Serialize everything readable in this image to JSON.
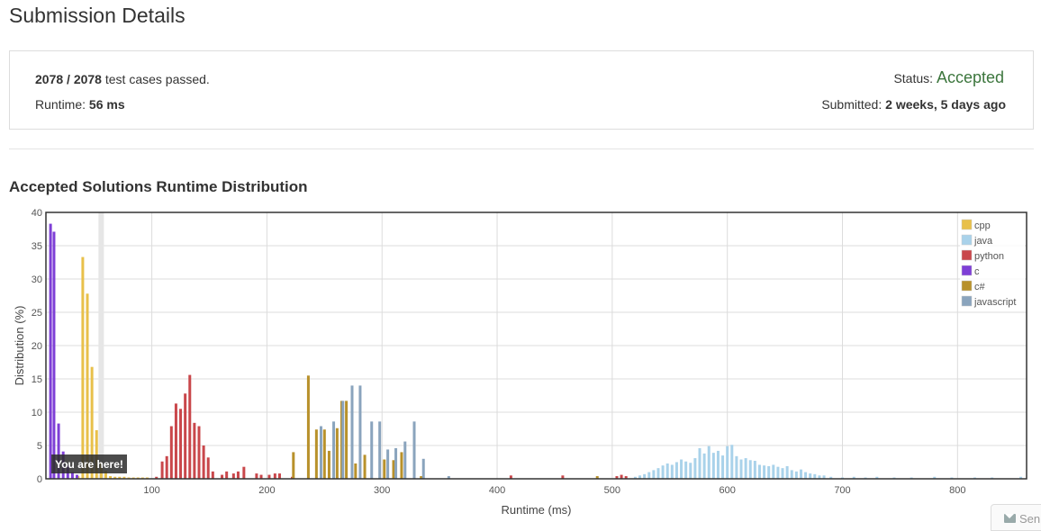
{
  "page": {
    "title": "Submission Details"
  },
  "summary": {
    "passed": "2078",
    "total": "2078",
    "passed_suffix": "test cases passed.",
    "runtime_label": "Runtime:",
    "runtime_value": "56 ms",
    "status_label": "Status:",
    "status_value": "Accepted",
    "status_color": "#3c763d",
    "submitted_label": "Submitted:",
    "submitted_value": "2 weeks, 5 days ago"
  },
  "chart_section": {
    "title": "Accepted Solutions Runtime Distribution"
  },
  "chart_data": {
    "type": "bar",
    "xlabel": "Runtime (ms)",
    "ylabel": "Distribution (%)",
    "xlim": [
      8,
      860
    ],
    "ylim": [
      0,
      40
    ],
    "xticks": [
      100,
      200,
      300,
      400,
      500,
      600,
      700,
      800
    ],
    "yticks": [
      0,
      5,
      10,
      15,
      20,
      25,
      30,
      35,
      40
    ],
    "grid": true,
    "legend_position": "top-right",
    "marker": {
      "x": 56,
      "label": "You are here!"
    },
    "series": [
      {
        "name": "cpp",
        "color": "#e8c04a",
        "points": [
          [
            36,
            0.4
          ],
          [
            40,
            33.3
          ],
          [
            44,
            27.8
          ],
          [
            48,
            16.8
          ],
          [
            52,
            7.3
          ],
          [
            56,
            2.5
          ],
          [
            60,
            1.2
          ],
          [
            64,
            0.4
          ],
          [
            68,
            0.3
          ],
          [
            72,
            0.3
          ],
          [
            76,
            0.3
          ],
          [
            80,
            0.2
          ],
          [
            84,
            0.2
          ],
          [
            88,
            0.2
          ],
          [
            92,
            0.2
          ],
          [
            96,
            0.2
          ]
        ]
      },
      {
        "name": "java",
        "color": "#a9d2ea",
        "points": [
          [
            520,
            0.3
          ],
          [
            524,
            0.5
          ],
          [
            528,
            0.7
          ],
          [
            532,
            1.0
          ],
          [
            536,
            1.3
          ],
          [
            540,
            1.6
          ],
          [
            544,
            2.0
          ],
          [
            548,
            2.3
          ],
          [
            552,
            2.1
          ],
          [
            556,
            2.5
          ],
          [
            560,
            2.9
          ],
          [
            564,
            2.6
          ],
          [
            568,
            2.4
          ],
          [
            572,
            3.1
          ],
          [
            576,
            4.6
          ],
          [
            580,
            3.8
          ],
          [
            584,
            4.9
          ],
          [
            588,
            3.9
          ],
          [
            592,
            4.2
          ],
          [
            596,
            3.5
          ],
          [
            600,
            4.9
          ],
          [
            604,
            5.1
          ],
          [
            608,
            3.4
          ],
          [
            612,
            2.9
          ],
          [
            616,
            3.1
          ],
          [
            620,
            2.8
          ],
          [
            624,
            2.7
          ],
          [
            628,
            2.1
          ],
          [
            632,
            2.0
          ],
          [
            636,
            1.9
          ],
          [
            640,
            2.1
          ],
          [
            644,
            1.8
          ],
          [
            648,
            1.6
          ],
          [
            652,
            1.9
          ],
          [
            656,
            1.3
          ],
          [
            660,
            1.1
          ],
          [
            664,
            1.4
          ],
          [
            668,
            1.0
          ],
          [
            672,
            0.8
          ],
          [
            676,
            0.7
          ],
          [
            680,
            0.5
          ],
          [
            684,
            0.5
          ],
          [
            690,
            0.3
          ],
          [
            700,
            0.2
          ],
          [
            710,
            0.3
          ],
          [
            720,
            0.2
          ],
          [
            730,
            0.3
          ],
          [
            745,
            0.2
          ],
          [
            760,
            0.2
          ],
          [
            780,
            0.3
          ],
          [
            795,
            0.2
          ],
          [
            815,
            0.2
          ],
          [
            830,
            0.2
          ],
          [
            855,
            0.3
          ]
        ]
      },
      {
        "name": "python",
        "color": "#c9474b",
        "points": [
          [
            104,
            0.3
          ],
          [
            109,
            2.6
          ],
          [
            113,
            3.4
          ],
          [
            117,
            7.9
          ],
          [
            121,
            11.3
          ],
          [
            125,
            10.5
          ],
          [
            129,
            12.8
          ],
          [
            133,
            15.6
          ],
          [
            137,
            8.4
          ],
          [
            141,
            7.9
          ],
          [
            145,
            5.0
          ],
          [
            149,
            3.2
          ],
          [
            153,
            1.1
          ],
          [
            161,
            0.6
          ],
          [
            165,
            1.1
          ],
          [
            171,
            0.8
          ],
          [
            175,
            1.1
          ],
          [
            180,
            1.8
          ],
          [
            191,
            0.8
          ],
          [
            195,
            0.6
          ],
          [
            202,
            0.6
          ],
          [
            207,
            0.8
          ],
          [
            211,
            0.8
          ],
          [
            222,
            0.3
          ],
          [
            412,
            0.5
          ],
          [
            457,
            0.5
          ],
          [
            504,
            0.4
          ],
          [
            508,
            0.6
          ],
          [
            512,
            0.4
          ]
        ]
      },
      {
        "name": "c",
        "color": "#7e3fd6",
        "points": [
          [
            12,
            38.3
          ],
          [
            15,
            37.1
          ],
          [
            19,
            8.3
          ],
          [
            23,
            4.1
          ],
          [
            27,
            2.1
          ],
          [
            31,
            1.0
          ],
          [
            35,
            0.6
          ]
        ]
      },
      {
        "name": "c#",
        "color": "#b8912b",
        "points": [
          [
            223,
            4.0
          ],
          [
            236,
            15.5
          ],
          [
            243,
            7.4
          ],
          [
            250,
            7.4
          ],
          [
            254,
            4.2
          ],
          [
            261,
            7.6
          ],
          [
            265,
            11.7
          ],
          [
            269,
            11.7
          ],
          [
            277,
            2.3
          ],
          [
            285,
            3.6
          ],
          [
            302,
            2.9
          ],
          [
            310,
            2.8
          ],
          [
            317,
            4.0
          ],
          [
            334,
            0.4
          ],
          [
            487,
            0.4
          ]
        ]
      },
      {
        "name": "javascript",
        "color": "#8aa4bd",
        "points": [
          [
            247,
            7.9
          ],
          [
            258,
            8.6
          ],
          [
            266,
            11.7
          ],
          [
            274,
            14.0
          ],
          [
            281,
            14.0
          ],
          [
            291,
            8.6
          ],
          [
            298,
            8.6
          ],
          [
            305,
            4.4
          ],
          [
            312,
            4.6
          ],
          [
            320,
            5.6
          ],
          [
            328,
            8.6
          ],
          [
            336,
            3.0
          ],
          [
            358,
            0.4
          ]
        ]
      }
    ]
  },
  "footer": {
    "send_label": "Sen"
  }
}
